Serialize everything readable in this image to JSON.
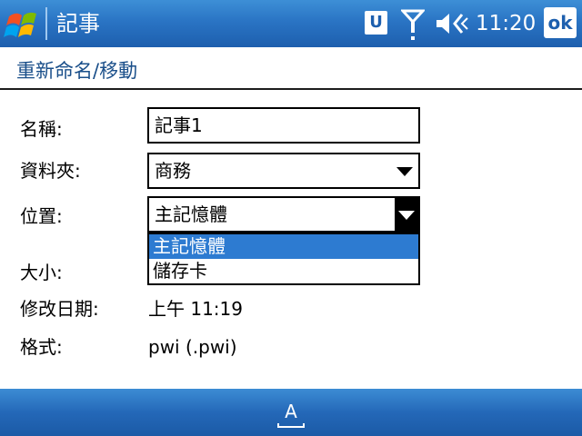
{
  "titlebar": {
    "app_title": "記事",
    "u_label": "U",
    "clock": "11:20",
    "ok_label": "ok"
  },
  "page": {
    "title": "重新命名/移動"
  },
  "form": {
    "name_label": "名稱:",
    "name_value": "記事1",
    "folder_label": "資料夾:",
    "folder_value": "商務",
    "location_label": "位置:",
    "location_value": "主記憶體",
    "location_options": [
      "主記憶體",
      "儲存卡"
    ],
    "size_label": "大小:",
    "modified_label": "修改日期:",
    "modified_value": "上午 11:19",
    "format_label": "格式:",
    "format_value": "pwi (.pwi)"
  },
  "bottombar": {
    "sip_label": "A"
  },
  "colors": {
    "titlebar": "#2a74c4",
    "selection": "#2d7bd1",
    "page_title": "#1a4f8a"
  }
}
